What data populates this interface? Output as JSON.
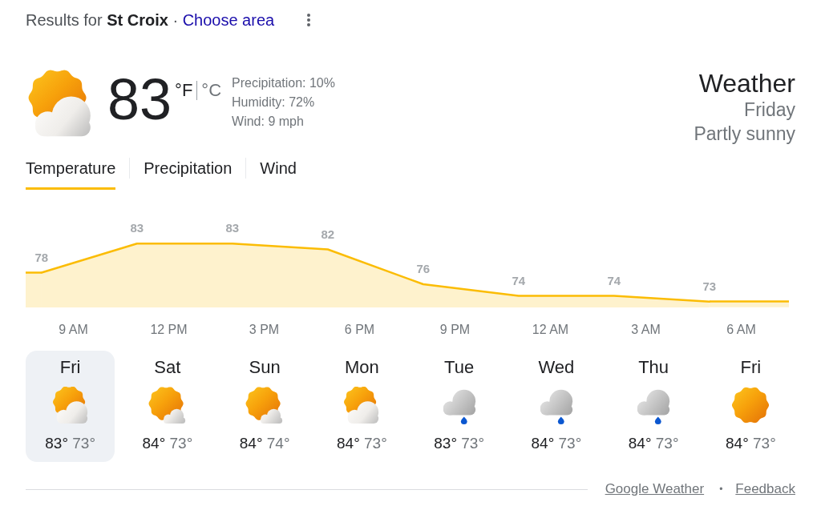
{
  "header": {
    "text": "Results for **St Croix** ·",
    "link": "Choose area"
  },
  "current": {
    "kind": "partly_cloudy",
    "temperature": "83",
    "units": [
      {
        "label": "°F",
        "selected": true
      },
      {
        "label": "°C",
        "selected": false
      }
    ],
    "details": [
      "Precipitation: 10%",
      "Humidity: 72%",
      "Wind: 9 mph"
    ]
  },
  "summary": {
    "title": "Weather",
    "day": "Friday",
    "condition": "Partly sunny"
  },
  "tabs": [
    {
      "label": "Temperature",
      "selected": true
    },
    {
      "label": "Precipitation",
      "selected": false
    },
    {
      "label": "Wind",
      "selected": false
    }
  ],
  "chart": {
    "chart_data": {
      "type": "area",
      "categories": [
        null,
        "9 AM",
        null,
        null,
        "12 PM",
        null,
        null,
        "3 PM",
        null,
        null,
        "6 PM",
        null,
        null,
        "9 PM",
        null,
        null,
        "12 AM",
        null,
        null,
        "3 AM",
        null,
        null,
        "6 AM",
        null
      ],
      "series": [
        {
          "color": "#fbbc04",
          "values": [
            78,
            null,
            null,
            83,
            null,
            null,
            83,
            null,
            null,
            82,
            null,
            null,
            76,
            null,
            null,
            74,
            null,
            null,
            74,
            null,
            null,
            73,
            null,
            null
          ]
        }
      ],
      "data_labels": true
    }
  },
  "days": [
    {
      "day": "Fri",
      "kind": "partly_cloudy",
      "high": "83°",
      "low": "73°",
      "selected": true
    },
    {
      "day": "Sat",
      "kind": "mostly_sunny",
      "high": "84°",
      "low": "73°",
      "selected": false
    },
    {
      "day": "Sun",
      "kind": "mostly_sunny",
      "high": "84°",
      "low": "74°",
      "selected": false
    },
    {
      "day": "Mon",
      "kind": "partly_cloudy",
      "high": "84°",
      "low": "73°",
      "selected": false
    },
    {
      "day": "Tue",
      "kind": "rain",
      "high": "83°",
      "low": "73°",
      "selected": false
    },
    {
      "day": "Wed",
      "kind": "rain",
      "high": "84°",
      "low": "73°",
      "selected": false
    },
    {
      "day": "Thu",
      "kind": "rain",
      "high": "84°",
      "low": "73°",
      "selected": false
    },
    {
      "day": "Fri",
      "kind": "sunny",
      "high": "84°",
      "low": "73°",
      "selected": false
    }
  ],
  "footer": {
    "links": [
      "Google Weather",
      "Feedback"
    ],
    "separator": "•"
  }
}
